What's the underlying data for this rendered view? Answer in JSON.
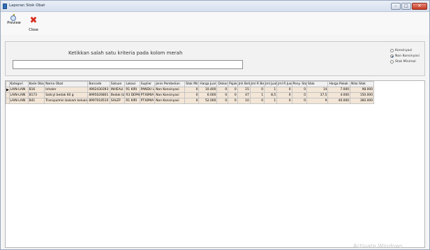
{
  "window": {
    "title": "Laporan Stok Obat",
    "controls": {
      "minimize": "–",
      "maximize": "□",
      "close": "✕"
    }
  },
  "toolbar": {
    "preview_label": "Preview",
    "close_label": "Close"
  },
  "filter": {
    "hint": "Ketikkan salah satu kriteria pada kolom merah",
    "search_value": "",
    "options": [
      {
        "label": "Konsinyasi",
        "checked": false
      },
      {
        "label": "Non Konsinyasi",
        "checked": true
      },
      {
        "label": "Stok Minimal",
        "checked": false
      }
    ]
  },
  "table": {
    "columns": [
      "Kategori",
      "Kode Obat",
      "Nama Obat",
      "Barcode",
      "Satuan",
      "Lokasi",
      "Suplier",
      "Jenis Pembelian",
      "Stok Min.",
      "Harga Jual",
      "Diskon",
      "Pajak",
      "Jml Beli",
      "Jml R Beli",
      "Jml Jual",
      "Jml R Jual",
      "Peny. Stok",
      "Stok",
      "Harga Pokok",
      "Nilai Stok"
    ],
    "rows": [
      [
        "LAIN-LAIN",
        "B16",
        "Inhaler",
        "4902430393",
        "INHEALI",
        "R1 KIRI",
        "PANDU L",
        "Non Konsinyasi",
        "0",
        "10.400",
        "0",
        "0",
        "15",
        "0",
        "1",
        "0",
        "0",
        "14",
        "7.000",
        "98.000"
      ],
      [
        "LAIN-LAIN",
        "B173",
        "Salicyl bedak 60 g",
        "8995026801",
        "Bedak tz",
        "R3 DEPAN",
        "PT.KIMIA",
        "Non Konsinyasi",
        "0",
        "6.000",
        "0",
        "0",
        "47",
        "1",
        "8,5",
        "0",
        "0",
        "37,5",
        "4.000",
        "150.000"
      ],
      [
        "LAIN-LAIN",
        "B41",
        "Transpulmin balsam keluarga",
        "8997018510",
        "SALEP",
        "R1 KIRI",
        "PT.KIMIA",
        "Non Konsinyasi",
        "0",
        "52.000",
        "0",
        "0",
        "10",
        "0",
        "1",
        "0",
        "0",
        "9",
        "40.000",
        "360.000"
      ]
    ]
  },
  "watermark": "Activate Windows"
}
